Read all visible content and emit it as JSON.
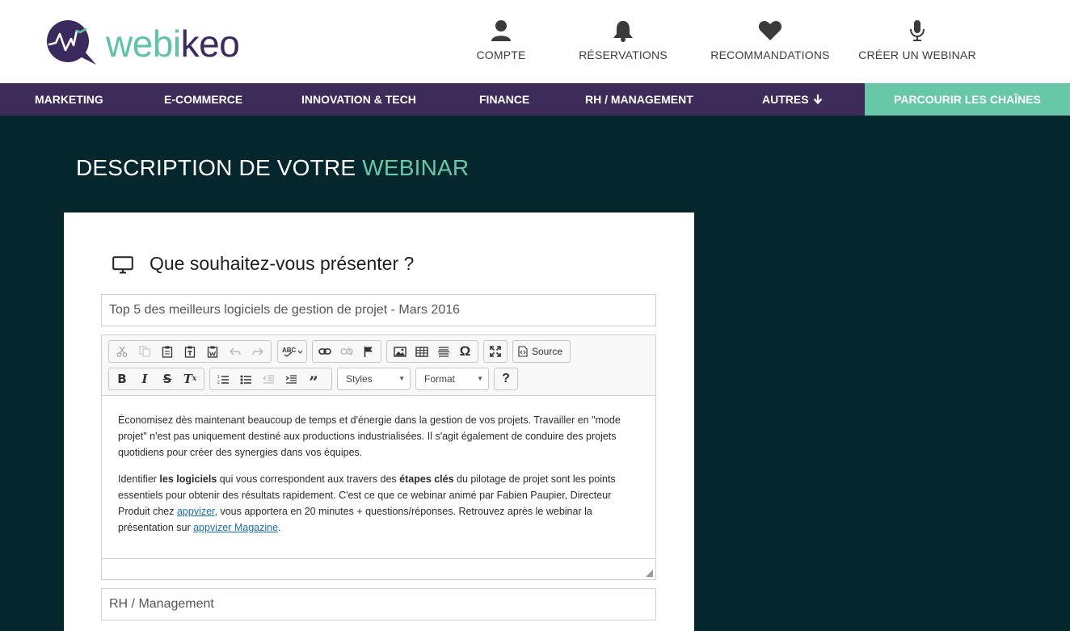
{
  "brand": {
    "text_a": "webi",
    "text_b": "keo"
  },
  "top_nav": [
    {
      "label": "COMPTE",
      "icon": "user-icon"
    },
    {
      "label": "RÉSERVATIONS",
      "icon": "bell-icon"
    },
    {
      "label": "RECOMMANDATIONS",
      "icon": "heart-icon"
    },
    {
      "label": "CRÉER UN WEBINAR",
      "icon": "microphone-icon"
    }
  ],
  "categories": [
    {
      "label": "MARKETING"
    },
    {
      "label": "E-COMMERCE"
    },
    {
      "label": "INNOVATION & TECH"
    },
    {
      "label": "FINANCE"
    },
    {
      "label": "RH / MANAGEMENT"
    },
    {
      "label": "AUTRES",
      "icon": "arrow-down-icon"
    }
  ],
  "browse_channels": "PARCOURIR LES CHAÎNES",
  "page_title": {
    "main": "DESCRIPTION DE VOTRE ",
    "accent": "WEBINAR"
  },
  "section": {
    "title": "Que souhaitez-vous présenter ?",
    "icon": "monitor-icon"
  },
  "form": {
    "title_value": "Top 5 des meilleurs logiciels de gestion de projet - Mars 2016",
    "category_value": "RH / Management"
  },
  "editor": {
    "source_label": "Source",
    "styles_label": "Styles",
    "format_label": "Format",
    "help_label": "?",
    "p1": "Économisez dès maintenant beaucoup de temps et d'énergie dans la gestion de vos projets. Travailler en \"mode projet\" n'est pas uniquement destiné aux productions industrialisées. Il s'agit également de conduire des projets quotidiens pour créer des synergies dans vos équipes.",
    "p2_a": "Identifier ",
    "p2_b": "les logiciels",
    "p2_c": " qui vous correspondent aux travers des ",
    "p2_d": "étapes clés",
    "p2_e": " du pilotage de projet sont les points essentiels pour obtenir des résultats rapidement. C'est ce que ce webinar animé par Fabien Paupier, Directeur Produit chez ",
    "p2_link1": "appvizer",
    "p2_f": ", vous apportera en 20 minutes + questions/réponses. Retrouvez après le webinar la présentation sur ",
    "p2_link2": "appvizer Magazine",
    "p2_g": "."
  },
  "colors": {
    "header_bg": "#ffffff",
    "category_bar": "#3d2b5a",
    "accent_green": "#67c7a6",
    "page_bg": "#04272d",
    "logo_purple": "#3a2a5e"
  }
}
